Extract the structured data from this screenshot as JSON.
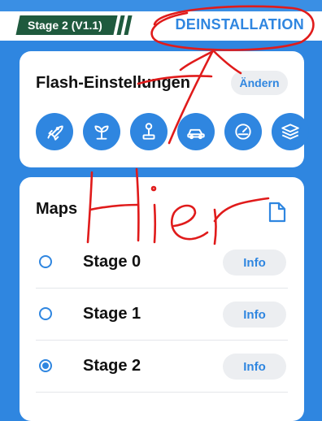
{
  "top_bar": {
    "stage_tag": "Stage 2 (V1.1)",
    "uninstall_label": "DEINSTALLATION"
  },
  "flash_settings": {
    "title": "Flash-Einstellungen",
    "change_label": "Ändern",
    "icons": [
      "rocket-icon",
      "sprout-icon",
      "joystick-icon",
      "car-icon",
      "gauge-icon",
      "layers-icon"
    ]
  },
  "maps": {
    "title": "Maps",
    "items": [
      {
        "label": "Stage 0",
        "selected": false,
        "info_label": "Info"
      },
      {
        "label": "Stage 1",
        "selected": false,
        "info_label": "Info"
      },
      {
        "label": "Stage 2",
        "selected": true,
        "info_label": "Info"
      }
    ]
  },
  "annotation": {
    "handwritten_text": "Hier",
    "color": "#e01b1b"
  },
  "colors": {
    "accent": "#2f86e0",
    "tag_green": "#1f5a3e"
  }
}
